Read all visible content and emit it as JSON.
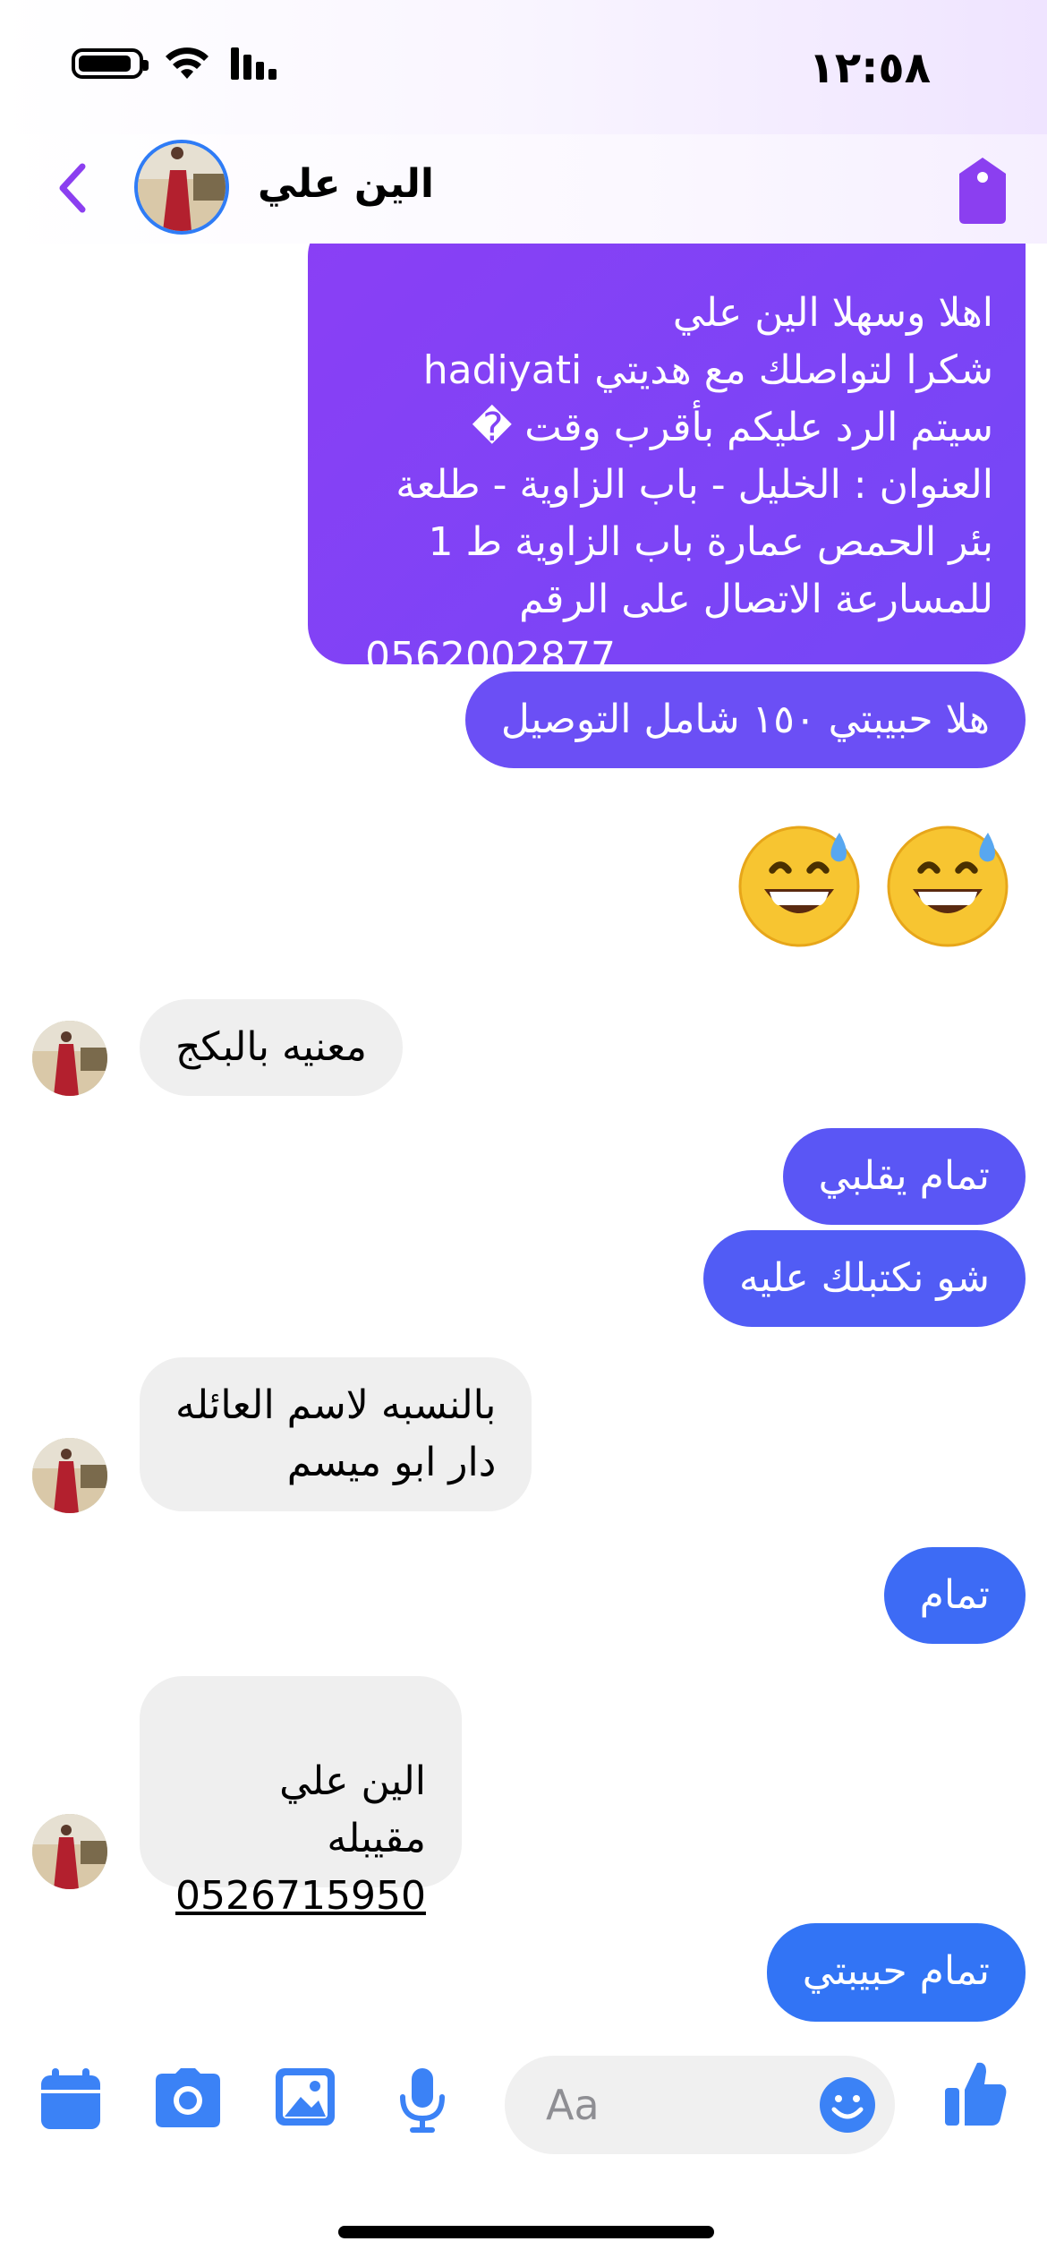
{
  "status_bar": {
    "time": "١٢:٥٨",
    "icons": [
      "battery-icon",
      "wifi-icon",
      "signal-icon"
    ]
  },
  "header": {
    "contact_name": "الين علي",
    "icons": [
      "back-chevron-icon",
      "contact-avatar",
      "tag-icon"
    ]
  },
  "messages": [
    {
      "direction": "out",
      "text": "اهلا وسهلا الين علي\nشكرا لتواصلك مع هديتي hadiyati\nسيتم الرد عليكم بأقرب وقت �\nالعنوان :  الخليل - باب الزاوية - طلعة بئر الحمص عمارة باب الزاوية ط 1\nللمسارعة الاتصال على الرقم",
      "phone": "0562002877"
    },
    {
      "direction": "out",
      "text": "هلا حبيبتي ١٥٠ شامل التوصيل"
    },
    {
      "direction": "out",
      "emoji": "😅😅"
    },
    {
      "direction": "in",
      "text": "معنيه بالبكج"
    },
    {
      "direction": "out",
      "text": "تمام يقلبي"
    },
    {
      "direction": "out",
      "text": "شو نكتبلك عليه"
    },
    {
      "direction": "in",
      "text": "بالنسبه لاسم العائله\nدار ابو ميسم"
    },
    {
      "direction": "out",
      "text": "تمام"
    },
    {
      "direction": "in",
      "text": "الين علي\nمقيبله",
      "phone": "0526715950"
    },
    {
      "direction": "out",
      "text": "تمام حبيبتي"
    }
  ],
  "composer": {
    "placeholder": "Aa",
    "buttons": [
      "calendar-icon",
      "camera-icon",
      "gallery-icon",
      "microphone-icon",
      "emoji-icon",
      "thumbs-up-icon"
    ]
  },
  "colors": {
    "accent": "#3b82f6",
    "header_icon": "#8b3ff0",
    "bubble_top": "#8a3ff5",
    "bubble_bottom": "#3274f5",
    "incoming_bg": "#efefef"
  }
}
